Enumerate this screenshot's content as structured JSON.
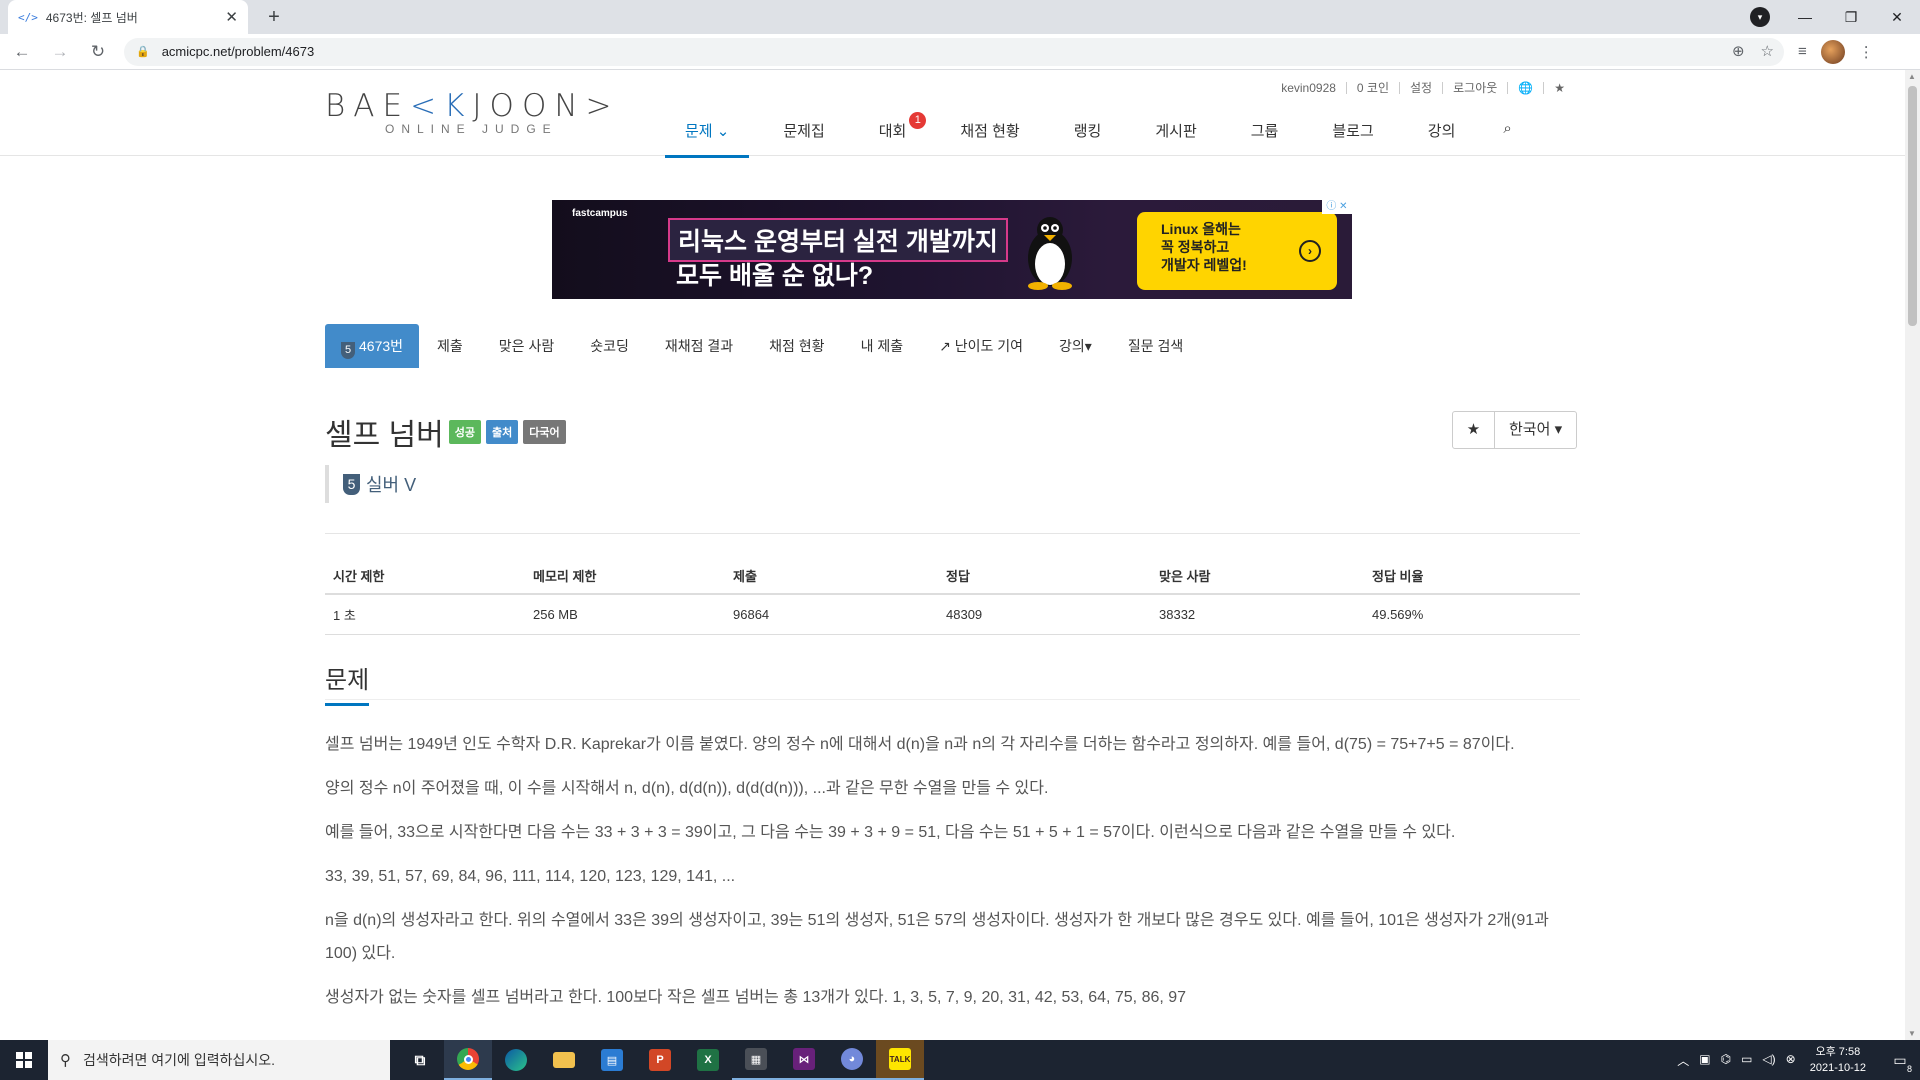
{
  "browser": {
    "tab_title": "4673번: 셀프 넘버",
    "tab_favicon": "</>",
    "url": "acmicpc.net/problem/4673"
  },
  "header": {
    "logo_main": "BAE",
    "logo_k": "<K",
    "logo_end": "JOON>",
    "logo_sub": "ONLINE JUDGE",
    "top_links": [
      "kevin0928",
      "0 코인",
      "설정",
      "로그아웃",
      "🌐",
      "★"
    ],
    "nav": [
      {
        "label": "문제 ⌄",
        "active": true
      },
      {
        "label": "문제집"
      },
      {
        "label": "대회",
        "badge": "1"
      },
      {
        "label": "채점 현황"
      },
      {
        "label": "랭킹"
      },
      {
        "label": "게시판"
      },
      {
        "label": "그룹"
      },
      {
        "label": "블로그"
      },
      {
        "label": "강의"
      }
    ]
  },
  "ad": {
    "brand": "fastcampus",
    "headline1": "리눅스 운영부터 실전 개발까지",
    "headline2": "모두 배울 순 없나?",
    "cta_line1": "Linux 올해는",
    "cta_line2": "꼭 정복하고",
    "cta_line3": "개발자 레벨업!",
    "cta_arrow": "›",
    "close": "ⓘ ✕"
  },
  "subnav": {
    "problem_tier": "5",
    "problem_number": "4673번",
    "items": [
      "제출",
      "맞은 사람",
      "숏코딩",
      "재채점 결과",
      "채점 현황",
      "내 제출",
      "↗ 난이도 기여",
      "강의▾",
      "질문 검색"
    ]
  },
  "problem": {
    "title": "셀프 넘버",
    "labels": [
      "성공",
      "출처",
      "다국어"
    ],
    "star": "★",
    "language": "한국어",
    "tier_num": "5",
    "tier_name": "실버 V"
  },
  "stats": {
    "headers": [
      "시간 제한",
      "메모리 제한",
      "제출",
      "정답",
      "맞은 사람",
      "정답 비율"
    ],
    "values": [
      "1 초",
      "256 MB",
      "96864",
      "48309",
      "38332",
      "49.569%"
    ]
  },
  "section": {
    "heading": "문제",
    "paragraphs": [
      "셀프 넘버는 1949년 인도 수학자 D.R. Kaprekar가 이름 붙였다. 양의 정수 n에 대해서 d(n)을 n과 n의 각 자리수를 더하는 함수라고 정의하자. 예를 들어, d(75) = 75+7+5 = 87이다.",
      "양의 정수 n이 주어졌을 때, 이 수를 시작해서 n, d(n), d(d(n)), d(d(d(n))), ...과 같은 무한 수열을 만들 수 있다.",
      "예를 들어, 33으로 시작한다면 다음 수는 33 + 3 + 3 = 39이고, 그 다음 수는 39 + 3 + 9 = 51, 다음 수는 51 + 5 + 1 = 57이다. 이런식으로 다음과 같은 수열을 만들 수 있다.",
      "33, 39, 51, 57, 69, 84, 96, 111, 114, 120, 123, 129, 141, ...",
      "n을 d(n)의 생성자라고 한다. 위의 수열에서 33은 39의 생성자이고, 39는 51의 생성자, 51은 57의 생성자이다. 생성자가 한 개보다 많은 경우도 있다. 예를 들어, 101은 생성자가 2개(91과 100) 있다.",
      "생성자가 없는 숫자를 셀프 넘버라고 한다. 100보다 작은 셀프 넘버는 총 13개가 있다. 1, 3, 5, 7, 9, 20, 31, 42, 53, 64, 75, 86, 97"
    ]
  },
  "taskbar": {
    "search_placeholder": "검색하려면 여기에 입력하십시오.",
    "time": "오후 7:58",
    "date": "2021-10-12",
    "notifications": "8"
  }
}
